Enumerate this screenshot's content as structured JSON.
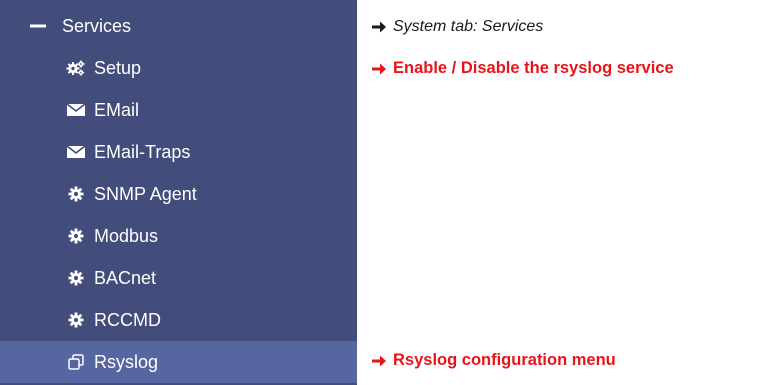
{
  "sidebar": {
    "section": {
      "label": "Services",
      "icon": "minus-icon"
    },
    "items": [
      {
        "label": "Setup",
        "icon": "gears-icon"
      },
      {
        "label": "EMail",
        "icon": "envelope-icon"
      },
      {
        "label": "EMail-Traps",
        "icon": "envelope-icon"
      },
      {
        "label": "SNMP Agent",
        "icon": "gear-icon"
      },
      {
        "label": "Modbus",
        "icon": "gear-icon"
      },
      {
        "label": "BACnet",
        "icon": "gear-icon"
      },
      {
        "label": "RCCMD",
        "icon": "gear-icon"
      },
      {
        "label": "Rsyslog",
        "icon": "clone-icon",
        "active": true
      }
    ]
  },
  "annotations": [
    {
      "text": "System tab: Services"
    },
    {
      "text": "Enable / Disable the rsyslog service"
    },
    {
      "text": "Rsyslog configuration menu"
    }
  ],
  "colors": {
    "sidebar_background": "#434d7c",
    "active_item_background": "#5765a0",
    "highlight_text": "#e8141b",
    "note_text": "#1a1a1a"
  }
}
